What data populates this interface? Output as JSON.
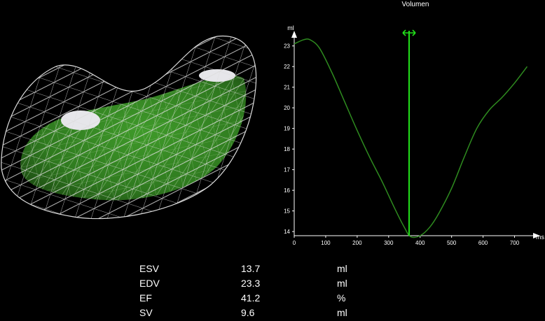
{
  "chart_data": {
    "type": "line",
    "title": "Volumen",
    "ylabel": "ml",
    "xlabel": "ms",
    "xlim": [
      0,
      750
    ],
    "ylim": [
      13.8,
      23.6
    ],
    "x_ticks": [
      "0",
      "100",
      "200",
      "300",
      "400",
      "500",
      "600",
      "700"
    ],
    "y_ticks": [
      "14",
      "15",
      "16",
      "17",
      "18",
      "19",
      "20",
      "21",
      "22",
      "23"
    ],
    "series": [
      {
        "x": [
          0,
          30,
          50,
          80,
          120,
          160,
          200,
          240,
          280,
          320,
          350,
          370,
          400,
          430,
          460,
          500,
          540,
          580,
          620,
          660,
          700,
          740
        ],
        "y": [
          23.1,
          23.3,
          23.3,
          22.9,
          21.7,
          20.3,
          18.9,
          17.6,
          16.4,
          15.1,
          14.2,
          13.75,
          13.8,
          14.2,
          14.9,
          16.1,
          17.6,
          19.0,
          19.9,
          20.5,
          21.2,
          22.0
        ]
      }
    ],
    "marker_x": 365,
    "grid": false,
    "colors": {
      "line": "#2e8b1f",
      "marker": "#22e01a",
      "axis": "#ffffff"
    }
  },
  "metrics": [
    {
      "name": "ESV",
      "value": "13.7",
      "unit": "ml"
    },
    {
      "name": "EDV",
      "value": "23.3",
      "unit": "ml"
    },
    {
      "name": "EF",
      "value": "41.2",
      "unit": "%"
    },
    {
      "name": "SV",
      "value": "9.6",
      "unit": "ml"
    }
  ],
  "colors": {
    "mesh": "#dcdcdc",
    "solid": "#2f7a1f",
    "background": "#000000"
  }
}
